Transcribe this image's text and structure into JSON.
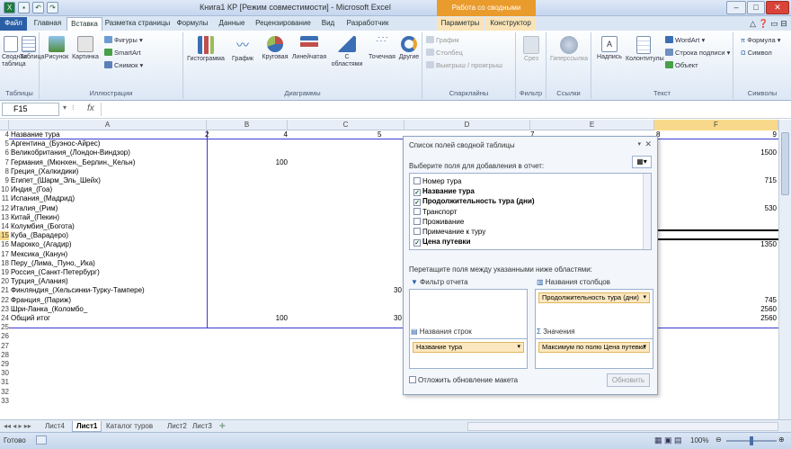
{
  "window": {
    "title": "Книга1 КР  [Режим совместимости]  -  Microsoft Excel",
    "context_title": "Работа со сводными таблицами",
    "minimize": "–",
    "maximize": "□",
    "close": "✕"
  },
  "ribbon_tabs": [
    "Файл",
    "Главная",
    "Вставка",
    "Разметка страницы",
    "Формулы",
    "Данные",
    "Рецензирование",
    "Вид",
    "Разработчик",
    "Параметры",
    "Конструктор"
  ],
  "ribbon": {
    "groups": [
      "Таблицы",
      "Иллюстрации",
      "Диаграммы",
      "Спарклайны",
      "Фильтр",
      "Ссылки",
      "Текст",
      "Символы"
    ],
    "tables": [
      "Сводная таблица",
      "Таблица"
    ],
    "illustrations": [
      "Рисунок",
      "Картинка"
    ],
    "illus_small": [
      "Фигуры",
      "SmartArt",
      "Снимок"
    ],
    "charts": [
      "Гистограмма",
      "График",
      "Круговая",
      "Линейчатая",
      "С областями",
      "Точечная",
      "Другие"
    ],
    "sparklines": [
      "График",
      "Столбец",
      "Выигрыш / проигрыш"
    ],
    "filter": "Срез",
    "links": "Гиперссылка",
    "text": [
      "Надпись",
      "Колонтитулы"
    ],
    "text_small": [
      "WordArt",
      "Строка подписи",
      "Объект"
    ],
    "symbols": [
      "Формула",
      "Символ"
    ]
  },
  "formula_bar": {
    "name_box": "F15",
    "fx": "fx",
    "value": ""
  },
  "columns": [
    "A",
    "B",
    "C",
    "D",
    "E",
    "F"
  ],
  "rows": [
    {
      "n": "4",
      "a": "Название тура",
      "b": "2",
      "c": "4",
      "d": "5",
      "e": "7",
      "f": "8",
      "g": "9"
    },
    {
      "n": "5",
      "a": "Аргентина_(Буэнос-Айрес)"
    },
    {
      "n": "6",
      "a": "Великобритания_(Лондон-Виндзор)",
      "g": "1500"
    },
    {
      "n": "7",
      "a": "Германия_(Мюнхен,_Берлин,_Кельн)",
      "c": "100"
    },
    {
      "n": "8",
      "a": "Греция_(Халкидики)"
    },
    {
      "n": "9",
      "a": "Египет_(Шарм_Эль_Шейх)",
      "g": "715"
    },
    {
      "n": "10",
      "a": "Индия_(Гоа)"
    },
    {
      "n": "11",
      "a": "Испания_(Мадрид)"
    },
    {
      "n": "12",
      "a": "Италия_(Рим)",
      "g": "530"
    },
    {
      "n": "13",
      "a": "Китай_(Пекин)"
    },
    {
      "n": "14",
      "a": "Колумбия_(Богота)"
    },
    {
      "n": "15",
      "a": "Куба_(Варадеро)"
    },
    {
      "n": "16",
      "a": "Марокко_(Агадир)",
      "g": "1350"
    },
    {
      "n": "17",
      "a": "Мексика_(Канун)"
    },
    {
      "n": "18",
      "a": "Перу_(Лима,_Пуно,_Ика)"
    },
    {
      "n": "19",
      "a": "Россия_(Санкт-Петербург)"
    },
    {
      "n": "20",
      "a": "Турция_(Алания)"
    },
    {
      "n": "21",
      "a": "Финляндия_(Хельсинки-Турку-Тампере)",
      "d": "30"
    },
    {
      "n": "22",
      "a": "Франция_(Париж)",
      "g": "745"
    },
    {
      "n": "23",
      "a": "Шри-Ланка_(Коломбо_",
      "g": "2560"
    },
    {
      "n": "24",
      "a": "Общий итог",
      "c": "100",
      "d": "30",
      "g": "2560"
    },
    {
      "n": "25"
    },
    {
      "n": "26"
    },
    {
      "n": "27"
    },
    {
      "n": "28"
    },
    {
      "n": "29"
    },
    {
      "n": "30"
    },
    {
      "n": "31"
    },
    {
      "n": "32"
    },
    {
      "n": "33"
    }
  ],
  "pivot_panel": {
    "title": "Список полей сводной таблицы",
    "choose_label": "Выберите поля для добавления в отчет:",
    "fields": [
      {
        "label": "Номер тура",
        "checked": false
      },
      {
        "label": "Название тура",
        "checked": true
      },
      {
        "label": "Продолжительность тура (дни)",
        "checked": true
      },
      {
        "label": "Транспорт",
        "checked": false
      },
      {
        "label": "Проживание",
        "checked": false
      },
      {
        "label": "Примечание к туру",
        "checked": false
      },
      {
        "label": "Цена путевки",
        "checked": true
      }
    ],
    "drag_hint": "Перетащите поля между указанными ниже областями:",
    "report_filter": "Фильтр отчета",
    "column_labels": "Названия столбцов",
    "row_labels": "Названия строк",
    "values": "Значения",
    "column_pill": "Продолжительность тура (дни)",
    "row_pill": "Название тура",
    "value_pill": "Максимум по полю Цена путевки",
    "defer": "Отложить обновление макета",
    "update": "Обновить"
  },
  "sheets": [
    "Лист4",
    "Лист1",
    "Каталог туров",
    "Лист2",
    "Лист3"
  ],
  "active_sheet": "Лист1",
  "status": {
    "ready": "Готово",
    "zoom": "100%"
  }
}
